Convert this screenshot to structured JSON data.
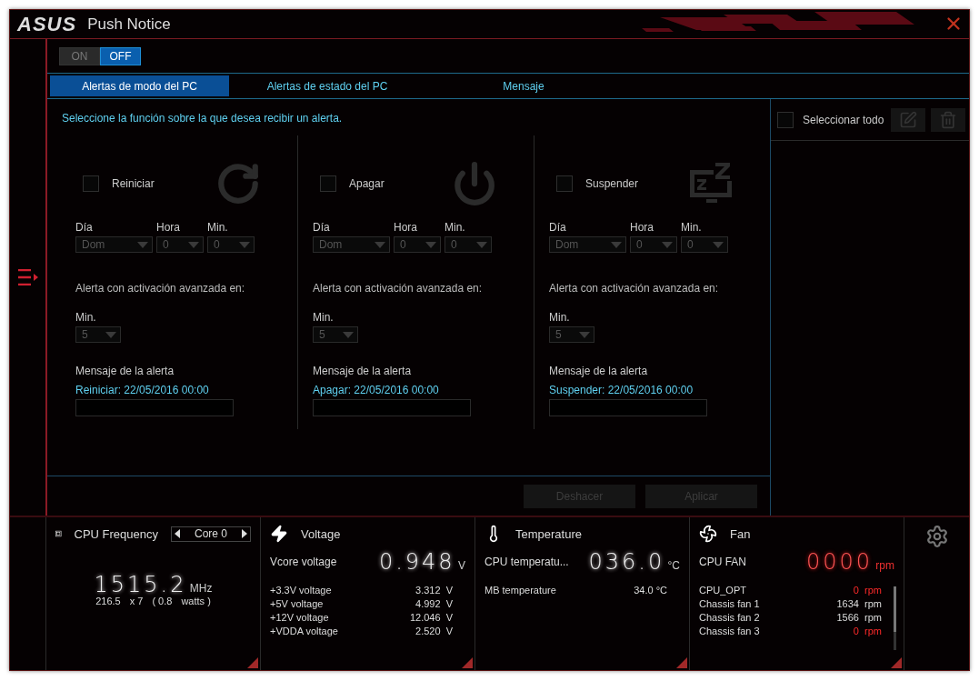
{
  "window": {
    "logo": "ASUS",
    "title": "Push Notice"
  },
  "power_toggle": [
    {
      "label": "ON",
      "selected": false
    },
    {
      "label": "OFF",
      "selected": true
    }
  ],
  "tabs": [
    {
      "label": "Alertas de modo del PC",
      "selected": true
    },
    {
      "label": "Alertas de estado del PC",
      "selected": false
    },
    {
      "label": "Mensaje",
      "selected": false
    }
  ],
  "instruction": "Seleccione la función sobre la que desea recibir un alerta.",
  "modes": [
    {
      "kind": "restart",
      "label": "Reiniciar",
      "checked": false,
      "day_label": "Día",
      "day": "Dom",
      "hour_label": "Hora",
      "hour": "0",
      "minute_label": "Min.",
      "minute": "0",
      "advance_label": "Alerta con activación avanzada en:",
      "advance_min_label": "Min.",
      "advance_min": "5",
      "message_label": "Mensaje de la alerta",
      "message": "Reiniciar: 22/05/2016 00:00"
    },
    {
      "kind": "shutdown",
      "label": "Apagar",
      "checked": false,
      "day_label": "Día",
      "day": "Dom",
      "hour_label": "Hora",
      "hour": "0",
      "minute_label": "Min.",
      "minute": "0",
      "advance_label": "Alerta con activación avanzada en:",
      "advance_min_label": "Min.",
      "advance_min": "5",
      "message_label": "Mensaje de la alerta",
      "message": "Apagar: 22/05/2016 00:00"
    },
    {
      "kind": "sleep",
      "label": "Suspender",
      "checked": false,
      "day_label": "Día",
      "day": "Dom",
      "hour_label": "Hora",
      "hour": "0",
      "minute_label": "Min.",
      "minute": "0",
      "advance_label": "Alerta con activación avanzada en:",
      "advance_min_label": "Min.",
      "advance_min": "5",
      "message_label": "Mensaje de la alerta",
      "message": "Suspender: 22/05/2016 00:00"
    }
  ],
  "actions": [
    {
      "label": "Deshacer",
      "disabled": true
    },
    {
      "label": "Aplicar",
      "disabled": true
    }
  ],
  "list_panel": {
    "select_all_label": "Seleccionar todo",
    "select_all_checked": false
  },
  "monitors": [
    {
      "kind": "cpu",
      "title": "CPU Frequency",
      "core": "Core 0",
      "value": "1515.2",
      "unit": "MHz",
      "detail": [
        "216.5",
        "x 7",
        "( 0.8",
        "watts )"
      ]
    },
    {
      "kind": "voltage",
      "title": "Voltage",
      "main_label": "Vcore voltage",
      "value": "0.948",
      "unit": "V",
      "rows": [
        {
          "label": "+3.3V voltage",
          "value": "3.312",
          "unit": "V",
          "alert": false
        },
        {
          "label": "+5V voltage",
          "value": "4.992",
          "unit": "V",
          "alert": false
        },
        {
          "label": "+12V voltage",
          "value": "12.046",
          "unit": "V",
          "alert": false
        },
        {
          "label": "+VDDA voltage",
          "value": "2.520",
          "unit": "V",
          "alert": false
        }
      ]
    },
    {
      "kind": "temperature",
      "title": "Temperature",
      "main_label": "CPU temperatu...",
      "value": "036.0",
      "unit": "°C",
      "rows": [
        {
          "label": "MB temperature",
          "value": "34.0 °C",
          "alert": false
        }
      ]
    },
    {
      "kind": "fan",
      "title": "Fan",
      "main_label": "CPU FAN",
      "value": "0000",
      "unit": "rpm",
      "alert": true,
      "rows": [
        {
          "label": "CPU_OPT",
          "value": "0",
          "unit": "rpm",
          "alert": true
        },
        {
          "label": "Chassis fan 1",
          "value": "1634",
          "unit": "rpm",
          "alert": false
        },
        {
          "label": "Chassis fan 2",
          "value": "1566",
          "unit": "rpm",
          "alert": false
        },
        {
          "label": "Chassis fan 3",
          "value": "0",
          "unit": "rpm",
          "alert": true
        }
      ]
    }
  ]
}
